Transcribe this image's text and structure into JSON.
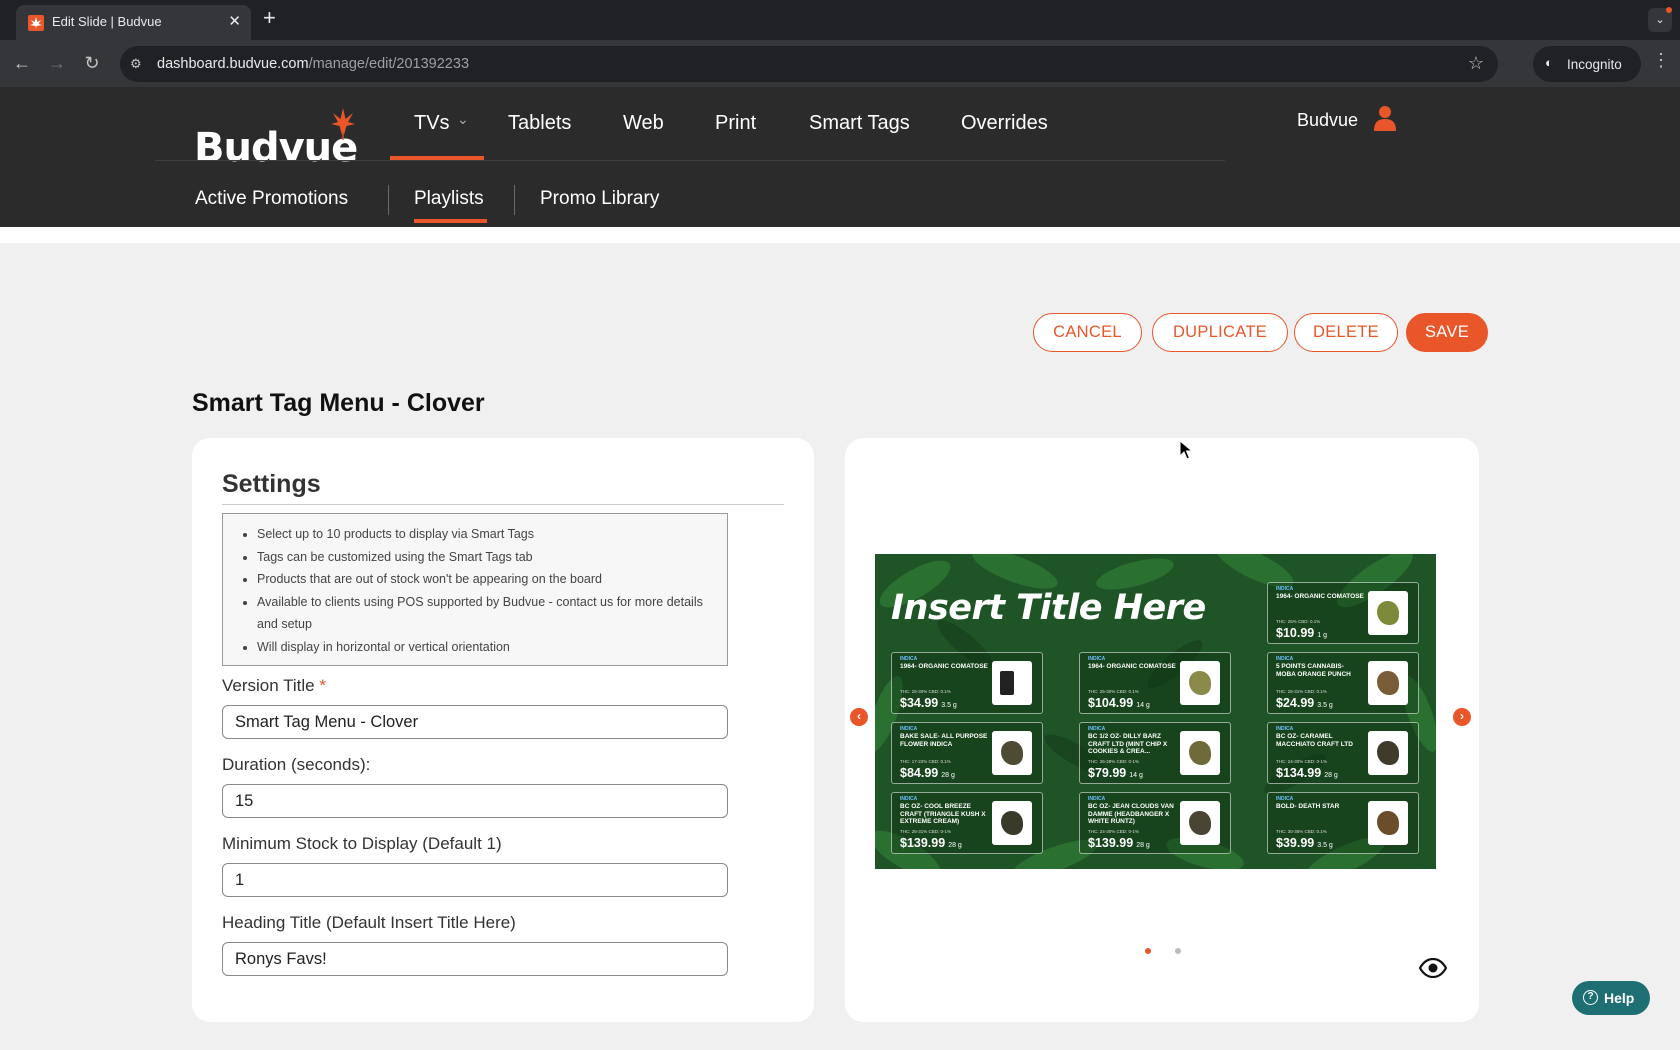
{
  "browser": {
    "tab_title": "Edit Slide | Budvue",
    "url_host": "dashboard.budvue.com",
    "url_path": "/manage/edit/201392233",
    "incognito_label": "Incognito",
    "icons": [
      "favicon-leaf-icon",
      "close-icon",
      "plus-icon",
      "back-icon",
      "forward-icon",
      "reload-icon",
      "site-info-icon",
      "star-icon",
      "incognito-icon",
      "kebab-icon"
    ]
  },
  "header": {
    "logo_text": "Budvue",
    "nav": [
      "TVs",
      "Tablets",
      "Web",
      "Print",
      "Smart Tags",
      "Overrides"
    ],
    "active_nav": "TVs",
    "user_name": "Budvue",
    "subnav": [
      "Active Promotions",
      "Playlists",
      "Promo Library"
    ],
    "active_subnav": "Playlists"
  },
  "actions": {
    "cancel": "CANCEL",
    "duplicate": "DUPLICATE",
    "delete": "DELETE",
    "save": "SAVE"
  },
  "page_title": "Smart Tag Menu - Clover",
  "settings": {
    "heading": "Settings",
    "info": [
      "Select up to 10 products to display via Smart Tags",
      "Tags can be customized using the Smart Tags tab",
      "Products that are out of stock won't be appearing on the board",
      "Available to clients using POS supported by Budvue - contact us for more details and setup",
      "Will display in horizontal or vertical orientation"
    ],
    "version_title_label": "Version Title",
    "required_mark": "*",
    "version_title_value": "Smart Tag Menu - Clover",
    "duration_label": "Duration (seconds):",
    "duration_value": "15",
    "min_stock_label": "Minimum Stock to Display (Default 1)",
    "min_stock_value": "1",
    "heading_title_label": "Heading Title (Default Insert Title Here)",
    "heading_title_value": "Ronys Favs!"
  },
  "preview": {
    "slide_title": "Insert Title Here",
    "products": [
      {
        "strain": "INDICA",
        "name": "1964- ORGANIC COMATOSE",
        "thc": "THC: 25% CBD: 0.1%",
        "price": "$10.99",
        "size": "1 g"
      },
      {
        "strain": "INDICA",
        "name": "1964- ORGANIC COMATOSE",
        "thc": "THC: 25-30% CBD: 0.1%",
        "price": "$34.99",
        "size": "3.5 g"
      },
      {
        "strain": "INDICA",
        "name": "1964- ORGANIC COMATOSE",
        "thc": "THC: 25-30% CBD: 0.1%",
        "price": "$104.99",
        "size": "14 g"
      },
      {
        "strain": "INDICA",
        "name": "5 POINTS CANNABIS- MOBA ORANGE PUNCH",
        "thc": "THC: 25-31% CBD: 0.1%",
        "price": "$24.99",
        "size": "3.5 g"
      },
      {
        "strain": "INDICA",
        "name": "BAKE SALE- ALL PURPOSE FLOWER INDICA",
        "thc": "THC: 17-22% CBD: 0.1%",
        "price": "$84.99",
        "size": "28 g"
      },
      {
        "strain": "INDICA",
        "name": "BC 1/2 OZ- DILLY BARZ CRAFT LTD (MINT CHIP X COOKIES & CREA...",
        "thc": "THC: 26-28% CBD: 0-1%",
        "price": "$79.99",
        "size": "14 g"
      },
      {
        "strain": "INDICA",
        "name": "BC OZ- CARAMEL MACCHIATO CRAFT LTD",
        "thc": "THC: 24-30% CBD: 0-1%",
        "price": "$134.99",
        "size": "28 g"
      },
      {
        "strain": "INDICA",
        "name": "BC OZ- COOL BREEZE CRAFT (TRIANGLE KUSH X EXTREME CREAM)",
        "thc": "THC: 26-31% CBD: 0-1%",
        "price": "$139.99",
        "size": "28 g"
      },
      {
        "strain": "INDICA",
        "name": "BC OZ- JEAN CLOUDS VAN DAMME (HEADBANGER X WHITE RUNTZ)",
        "thc": "THC: 24-30% CBD: 0-1%",
        "price": "$139.99",
        "size": "28 g"
      },
      {
        "strain": "INDICA",
        "name": "BOLD- DEATH STAR",
        "thc": "THC: 30-36% CBD: 0.1%",
        "price": "$39.99",
        "size": "3.5 g"
      }
    ],
    "prev_glyph": "‹",
    "next_glyph": "›"
  },
  "help": {
    "label": "Help",
    "glyph": "?"
  },
  "colors": {
    "accent": "#e8562a",
    "header_bg": "#2b2b2b",
    "help_bg": "#1e6f73"
  }
}
